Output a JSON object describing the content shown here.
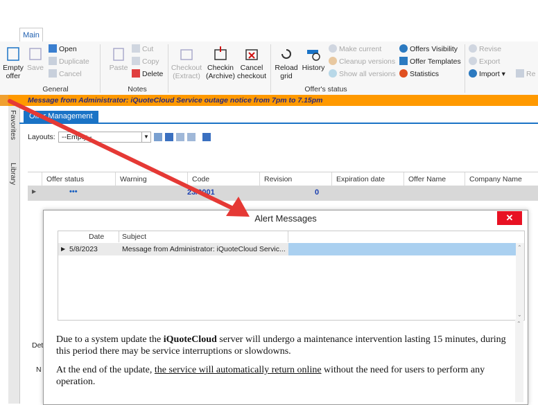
{
  "tabs": {
    "main": "Main"
  },
  "ribbon": {
    "empty_offer": "Empty offer",
    "save": "Save",
    "open": "Open",
    "duplicate": "Duplicate",
    "cancel": "Cancel",
    "paste": "Paste",
    "cut": "Cut",
    "copy": "Copy",
    "delete": "Delete",
    "checkout_extract": "Checkout (Extract)",
    "checkin_archive": "Checkin (Archive)",
    "cancel_checkout": "Cancel checkout",
    "reload_grid": "Reload grid",
    "history": "History",
    "make_current": "Make current",
    "cleanup_versions": "Cleanup versions",
    "show_all_versions": "Show all versions",
    "offers_visibility": "Offers Visibility",
    "offer_templates": "Offer Templates",
    "statistics": "Statistics",
    "revise": "Revise",
    "export": "Export",
    "import": "Import",
    "re": "Re",
    "groups": {
      "general": "General",
      "notes": "Notes",
      "offers_status": "Offer's status"
    }
  },
  "banner": {
    "text": "Message from Administrator: iQuoteCloud Service outage notice from 7pm to 7.15pm"
  },
  "side": {
    "favorites": "Favorites",
    "library": "Library"
  },
  "offer_tab": {
    "label": "Offer Management"
  },
  "layouts": {
    "label": "Layouts:",
    "value": "--Empty--"
  },
  "grid": {
    "columns": [
      "Offer status",
      "Warning",
      "Code",
      "Revision",
      "Expiration date",
      "Offer Name",
      "Company Name"
    ],
    "row": {
      "status": "•••",
      "code": "23/0001",
      "revision": "0"
    }
  },
  "bottom": {
    "det": "Det",
    "n": "N"
  },
  "dialog": {
    "title": "Alert Messages",
    "close": "✕",
    "list_headers": [
      "Date",
      "Subject"
    ],
    "rows": [
      {
        "date": "5/8/2023",
        "subject": "Message from Administrator: iQuoteCloud Servic..."
      }
    ],
    "p1_a": "Due to a system update the ",
    "p1_b": "iQuoteCloud",
    "p1_c": " server will undergo a maintenance intervention lasting 15 minutes, during this period there may be service interruptions or slowdowns.",
    "p2_a": "At the end of the update, ",
    "p2_b": "the service will automatically return online",
    "p2_c": " without the need for users to perform any operation."
  },
  "colors": {
    "accent": "#1a73c6",
    "banner": "#ff9900",
    "arrow": "#e53935",
    "close": "#e81123"
  }
}
